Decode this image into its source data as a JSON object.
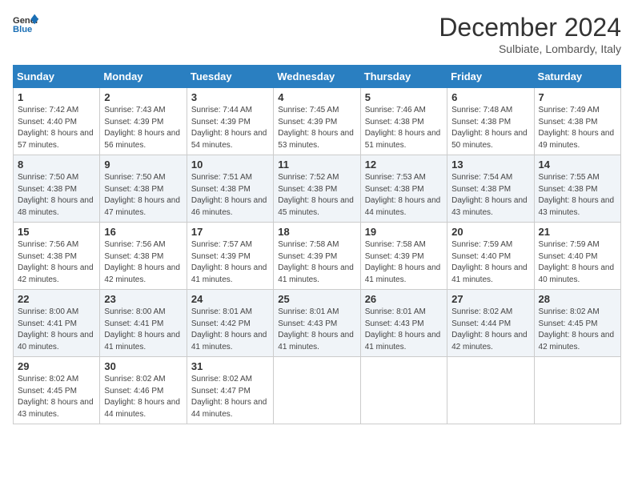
{
  "header": {
    "logo_line1": "General",
    "logo_line2": "Blue",
    "month": "December 2024",
    "location": "Sulbiate, Lombardy, Italy"
  },
  "days_of_week": [
    "Sunday",
    "Monday",
    "Tuesday",
    "Wednesday",
    "Thursday",
    "Friday",
    "Saturday"
  ],
  "weeks": [
    [
      {
        "day": 1,
        "sunrise": "7:42 AM",
        "sunset": "4:40 PM",
        "daylight": "8 hours and 57 minutes."
      },
      {
        "day": 2,
        "sunrise": "7:43 AM",
        "sunset": "4:39 PM",
        "daylight": "8 hours and 56 minutes."
      },
      {
        "day": 3,
        "sunrise": "7:44 AM",
        "sunset": "4:39 PM",
        "daylight": "8 hours and 54 minutes."
      },
      {
        "day": 4,
        "sunrise": "7:45 AM",
        "sunset": "4:39 PM",
        "daylight": "8 hours and 53 minutes."
      },
      {
        "day": 5,
        "sunrise": "7:46 AM",
        "sunset": "4:38 PM",
        "daylight": "8 hours and 51 minutes."
      },
      {
        "day": 6,
        "sunrise": "7:48 AM",
        "sunset": "4:38 PM",
        "daylight": "8 hours and 50 minutes."
      },
      {
        "day": 7,
        "sunrise": "7:49 AM",
        "sunset": "4:38 PM",
        "daylight": "8 hours and 49 minutes."
      }
    ],
    [
      {
        "day": 8,
        "sunrise": "7:50 AM",
        "sunset": "4:38 PM",
        "daylight": "8 hours and 48 minutes."
      },
      {
        "day": 9,
        "sunrise": "7:50 AM",
        "sunset": "4:38 PM",
        "daylight": "8 hours and 47 minutes."
      },
      {
        "day": 10,
        "sunrise": "7:51 AM",
        "sunset": "4:38 PM",
        "daylight": "8 hours and 46 minutes."
      },
      {
        "day": 11,
        "sunrise": "7:52 AM",
        "sunset": "4:38 PM",
        "daylight": "8 hours and 45 minutes."
      },
      {
        "day": 12,
        "sunrise": "7:53 AM",
        "sunset": "4:38 PM",
        "daylight": "8 hours and 44 minutes."
      },
      {
        "day": 13,
        "sunrise": "7:54 AM",
        "sunset": "4:38 PM",
        "daylight": "8 hours and 43 minutes."
      },
      {
        "day": 14,
        "sunrise": "7:55 AM",
        "sunset": "4:38 PM",
        "daylight": "8 hours and 43 minutes."
      }
    ],
    [
      {
        "day": 15,
        "sunrise": "7:56 AM",
        "sunset": "4:38 PM",
        "daylight": "8 hours and 42 minutes."
      },
      {
        "day": 16,
        "sunrise": "7:56 AM",
        "sunset": "4:38 PM",
        "daylight": "8 hours and 42 minutes."
      },
      {
        "day": 17,
        "sunrise": "7:57 AM",
        "sunset": "4:39 PM",
        "daylight": "8 hours and 41 minutes."
      },
      {
        "day": 18,
        "sunrise": "7:58 AM",
        "sunset": "4:39 PM",
        "daylight": "8 hours and 41 minutes."
      },
      {
        "day": 19,
        "sunrise": "7:58 AM",
        "sunset": "4:39 PM",
        "daylight": "8 hours and 41 minutes."
      },
      {
        "day": 20,
        "sunrise": "7:59 AM",
        "sunset": "4:40 PM",
        "daylight": "8 hours and 41 minutes."
      },
      {
        "day": 21,
        "sunrise": "7:59 AM",
        "sunset": "4:40 PM",
        "daylight": "8 hours and 40 minutes."
      }
    ],
    [
      {
        "day": 22,
        "sunrise": "8:00 AM",
        "sunset": "4:41 PM",
        "daylight": "8 hours and 40 minutes."
      },
      {
        "day": 23,
        "sunrise": "8:00 AM",
        "sunset": "4:41 PM",
        "daylight": "8 hours and 41 minutes."
      },
      {
        "day": 24,
        "sunrise": "8:01 AM",
        "sunset": "4:42 PM",
        "daylight": "8 hours and 41 minutes."
      },
      {
        "day": 25,
        "sunrise": "8:01 AM",
        "sunset": "4:43 PM",
        "daylight": "8 hours and 41 minutes."
      },
      {
        "day": 26,
        "sunrise": "8:01 AM",
        "sunset": "4:43 PM",
        "daylight": "8 hours and 41 minutes."
      },
      {
        "day": 27,
        "sunrise": "8:02 AM",
        "sunset": "4:44 PM",
        "daylight": "8 hours and 42 minutes."
      },
      {
        "day": 28,
        "sunrise": "8:02 AM",
        "sunset": "4:45 PM",
        "daylight": "8 hours and 42 minutes."
      }
    ],
    [
      {
        "day": 29,
        "sunrise": "8:02 AM",
        "sunset": "4:45 PM",
        "daylight": "8 hours and 43 minutes."
      },
      {
        "day": 30,
        "sunrise": "8:02 AM",
        "sunset": "4:46 PM",
        "daylight": "8 hours and 44 minutes."
      },
      {
        "day": 31,
        "sunrise": "8:02 AM",
        "sunset": "4:47 PM",
        "daylight": "8 hours and 44 minutes."
      },
      null,
      null,
      null,
      null
    ]
  ]
}
